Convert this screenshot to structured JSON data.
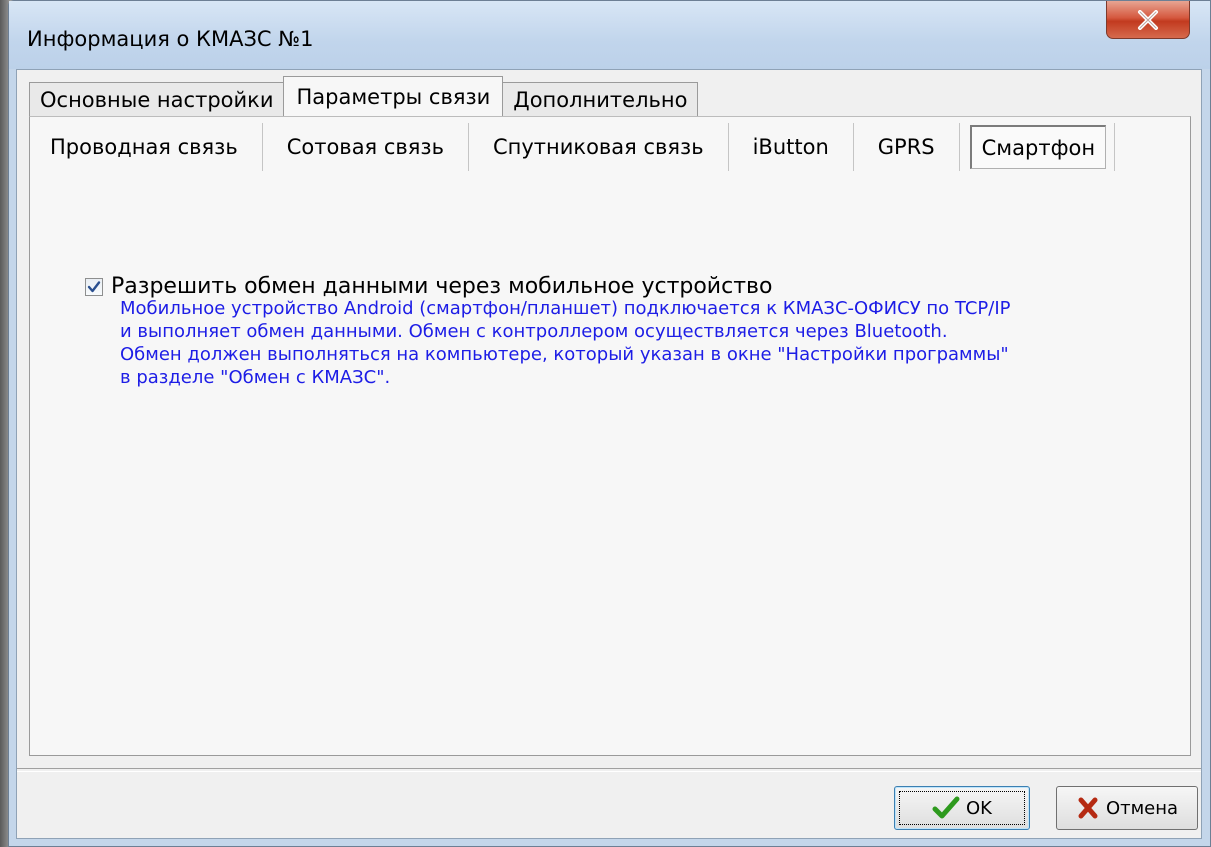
{
  "window": {
    "title": "Информация о КМАЗС №1"
  },
  "tabs": [
    {
      "label": "Основные настройки",
      "active": false
    },
    {
      "label": "Параметры связи",
      "active": true
    },
    {
      "label": "Дополнительно",
      "active": false
    }
  ],
  "subtabs": [
    {
      "label": "Проводная связь",
      "active": false
    },
    {
      "label": "Сотовая связь",
      "active": false
    },
    {
      "label": "Спутниковая связь",
      "active": false
    },
    {
      "label": "iButton",
      "active": false
    },
    {
      "label": "GPRS",
      "active": false
    },
    {
      "label": "Смартфон",
      "active": true
    }
  ],
  "smartphone": {
    "checkbox_label": "Разрешить обмен данными через мобильное устройство",
    "checked": true,
    "info_lines": [
      "Мобильное устройство Android (смартфон/планшет) подключается к КМАЗС-ОФИСУ по TCP/IP",
      "и выполняет обмен данными. Обмен с контроллером осуществляется через Bluetooth.",
      "Обмен должен выполняться на компьютере, который указан в окне \"Настройки программы\"",
      "в разделе \"Обмен с КМАЗС\"."
    ]
  },
  "buttons": {
    "ok_label": "OK",
    "cancel_label": "Отмена"
  },
  "colors": {
    "info_text": "#1d1de6",
    "ok_icon": "#2e9a1e",
    "cancel_icon": "#b52a12"
  },
  "icons": {
    "close": "close-icon",
    "ok": "checkmark-icon",
    "cancel": "red-x-icon"
  }
}
